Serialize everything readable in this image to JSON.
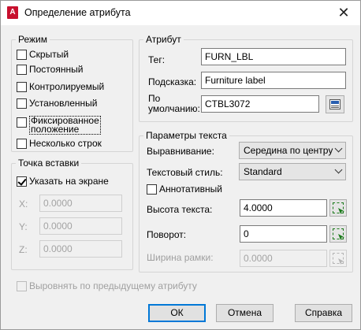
{
  "window": {
    "title": "Определение атрибута",
    "app_icon_letter": "A",
    "close_glyph": "✕"
  },
  "mode": {
    "legend": "Режим",
    "items": [
      {
        "label": "Скрытый",
        "checked": false
      },
      {
        "label": "Постоянный",
        "checked": false
      },
      {
        "label": "Контролируемый",
        "checked": false
      },
      {
        "label": "Установленный",
        "checked": false
      },
      {
        "label_line1": "Фиксированное",
        "label_line2": "положение",
        "checked": false
      },
      {
        "label": "Несколько строк",
        "checked": false
      }
    ]
  },
  "insertion": {
    "legend": "Точка вставки",
    "on_screen_label": "Указать на экране",
    "on_screen_checked": true,
    "x_label": "X:",
    "x_value": "0.0000",
    "y_label": "Y:",
    "y_value": "0.0000",
    "z_label": "Z:",
    "z_value": "0.0000"
  },
  "attribute": {
    "legend": "Атрибут",
    "tag_label": "Тег:",
    "tag_value": "FURN_LBL",
    "prompt_label": "Подсказка:",
    "prompt_value": "Furniture label",
    "default_label_line1": "По",
    "default_label_line2": "умолчанию:",
    "default_value": "CTBL3072"
  },
  "text_params": {
    "legend": "Параметры текста",
    "justify_label": "Выравнивание:",
    "justify_value": "Середина по центру",
    "style_label": "Текстовый стиль:",
    "style_value": "Standard",
    "annotative_label": "Аннотативный",
    "annotative_checked": false,
    "height_label": "Высота текста:",
    "height_value": "4.0000",
    "rotation_label": "Поворот:",
    "rotation_value": "0",
    "boundary_label": "Ширина рамки:",
    "boundary_value": "0.0000"
  },
  "align_prev_label": "Выровнять по предыдущему атрибуту",
  "buttons": {
    "ok": "ОК",
    "cancel": "Отмена",
    "help": "Справка"
  },
  "colors": {
    "accent": "#0078d7",
    "pick_icon": "#1a7a1a",
    "app_icon": "#c8102e"
  }
}
